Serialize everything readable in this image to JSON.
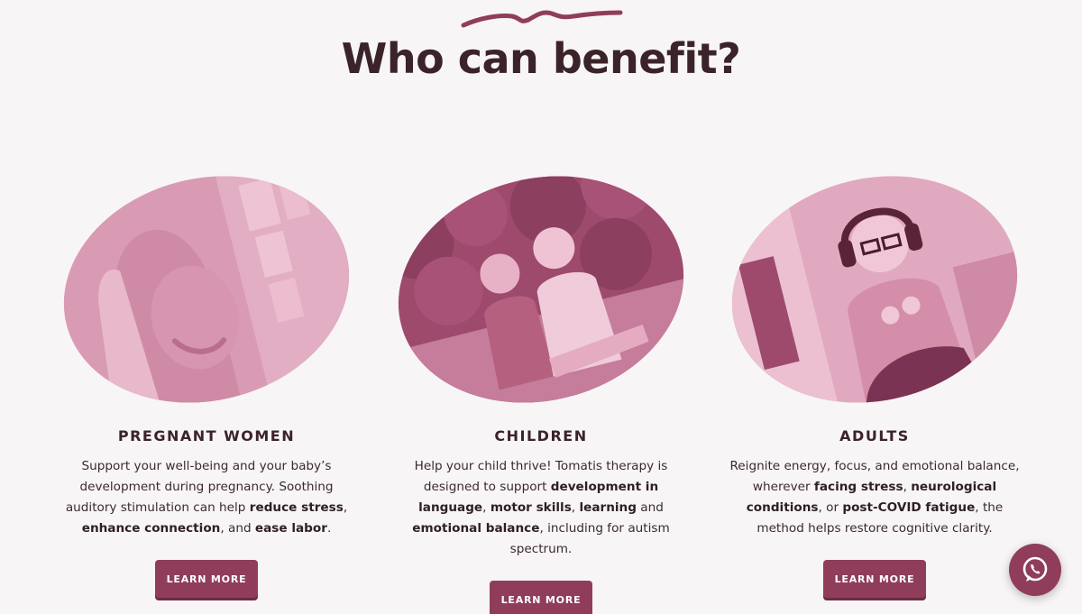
{
  "section": {
    "title": "Who can benefit?"
  },
  "cards": [
    {
      "heading": "PREGNANT WOMEN",
      "text": [
        {
          "t": "Support your well-being and your baby’s development during pregnancy. Soothing auditory stimulation can help ",
          "b": false
        },
        {
          "t": "reduce stress",
          "b": true
        },
        {
          "t": ", ",
          "b": false
        },
        {
          "t": "enhance connection",
          "b": true
        },
        {
          "t": ", and ",
          "b": false
        },
        {
          "t": "ease labor",
          "b": true
        },
        {
          "t": ".",
          "b": false
        }
      ],
      "button": "LEARN MORE"
    },
    {
      "heading": "CHILDREN",
      "text": [
        {
          "t": "Help your child thrive! Tomatis therapy is designed to support ",
          "b": false
        },
        {
          "t": "development in language",
          "b": true
        },
        {
          "t": ", ",
          "b": false
        },
        {
          "t": "motor skills",
          "b": true
        },
        {
          "t": ", ",
          "b": false
        },
        {
          "t": "learning",
          "b": true
        },
        {
          "t": " and ",
          "b": false
        },
        {
          "t": "emotional balance",
          "b": true
        },
        {
          "t": ", including for autism spectrum.",
          "b": false
        }
      ],
      "button": "LEARN MORE"
    },
    {
      "heading": "ADULTS",
      "text": [
        {
          "t": "Reignite energy, focus, and emotional balance, wherever ",
          "b": false
        },
        {
          "t": "facing stress",
          "b": true
        },
        {
          "t": ", ",
          "b": false
        },
        {
          "t": "neurological conditions",
          "b": true
        },
        {
          "t": ", or ",
          "b": false
        },
        {
          "t": "post-COVID fatigue",
          "b": true
        },
        {
          "t": ", the method helps restore cognitive clarity.",
          "b": false
        }
      ],
      "button": "LEARN MORE"
    }
  ],
  "icons": {
    "decoration": "brush-squiggle-icon",
    "floating": "whatsapp-icon"
  },
  "colors": {
    "accent": "#8f3d5b",
    "heading": "#3a2329",
    "photo_tint": "#d99bb3",
    "background": "#f8f5f6"
  }
}
